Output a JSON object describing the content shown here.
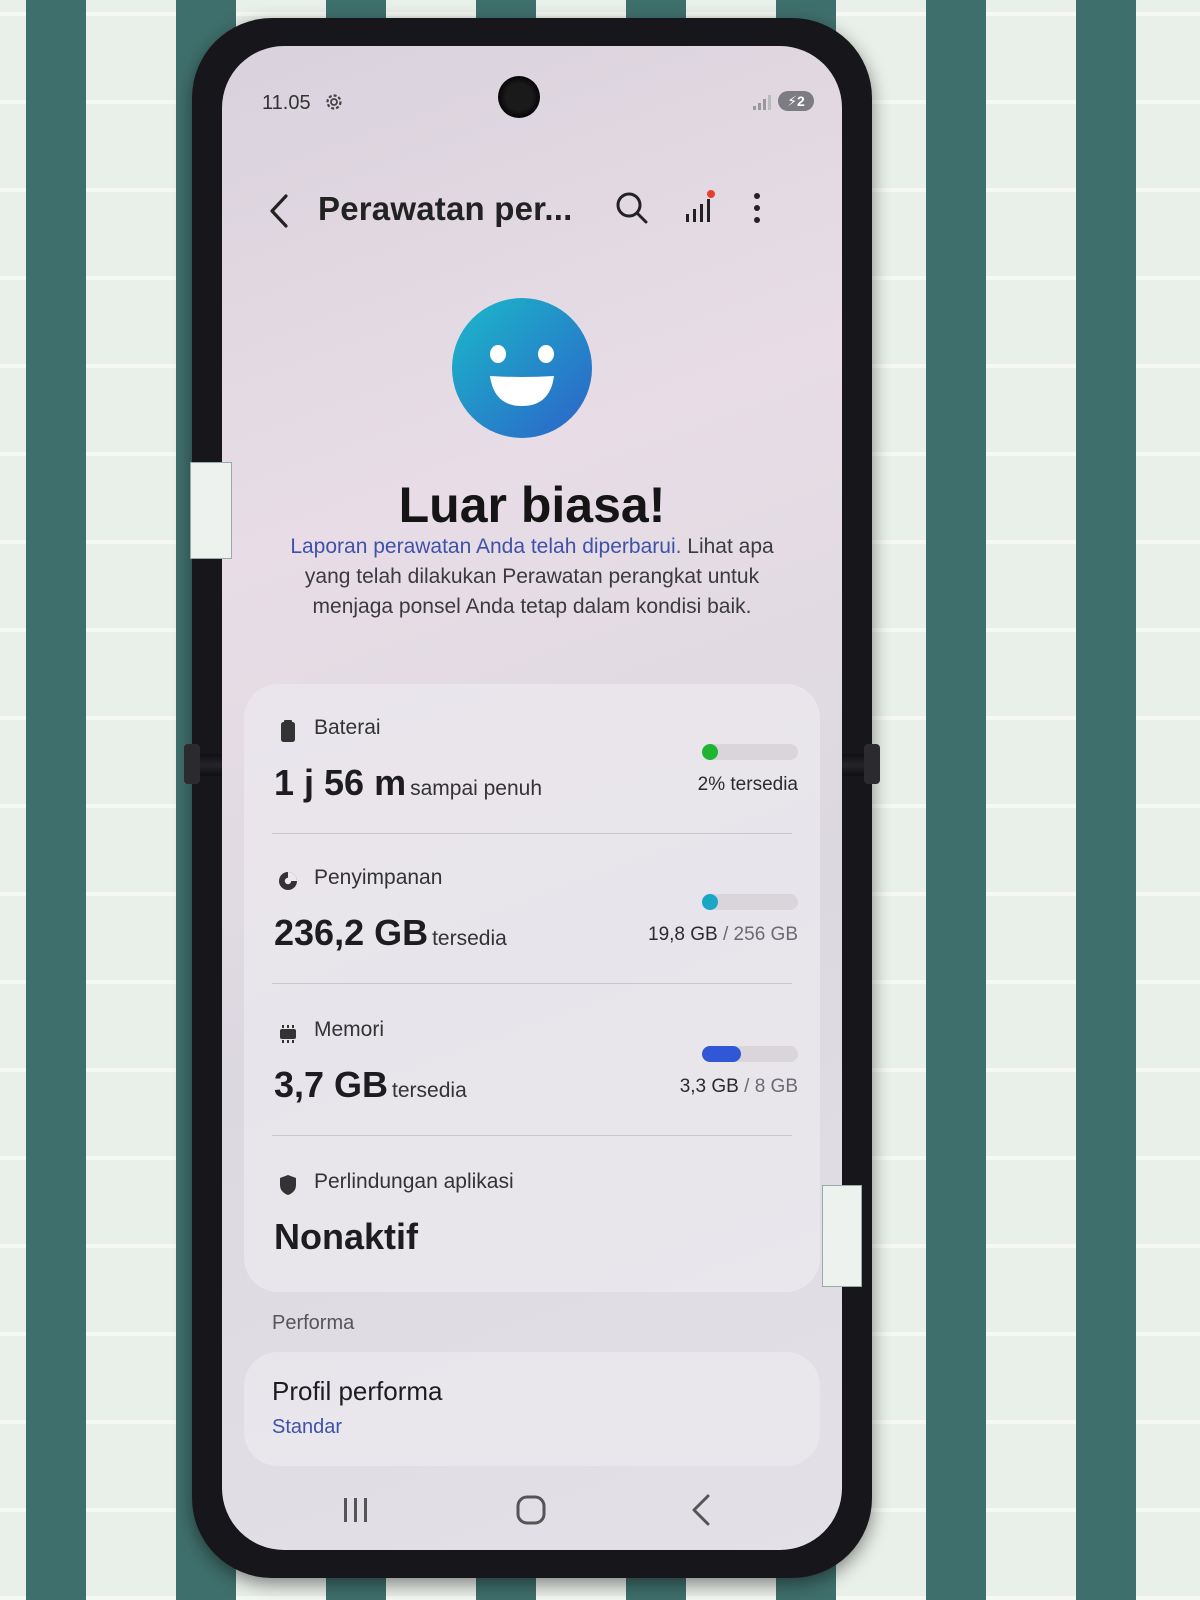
{
  "status_bar": {
    "time": "11.05",
    "battery_badge": "⚡2"
  },
  "app_bar": {
    "title": "Perawatan per..."
  },
  "hero": {
    "headline": "Luar biasa!",
    "link_text": "Laporan perawatan Anda telah diperbarui.",
    "description": " Lihat apa yang telah dilakukan Perawatan perangkat untuk menjaga ponsel Anda tetap dalam kondisi baik."
  },
  "battery": {
    "label": "Baterai",
    "value": "1 j 56 m",
    "suffix": "sampai penuh",
    "right": "2% tersedia",
    "level": 0.02,
    "color": "#1fb533"
  },
  "storage": {
    "label": "Penyimpanan",
    "value": "236,2 GB",
    "suffix": "tersedia",
    "used": "19,8 GB",
    "total": " / 256 GB",
    "level": 0.077,
    "color": "#1aa6c4"
  },
  "memory": {
    "label": "Memori",
    "value": "3,7 GB",
    "suffix": "tersedia",
    "used": "3,3 GB",
    "total": " / 8 GB",
    "level": 0.41,
    "color": "#2f57d6"
  },
  "protection": {
    "label": "Perlindungan aplikasi",
    "value": "Nonaktif"
  },
  "performance": {
    "section": "Performa",
    "title": "Profil performa",
    "subtitle": "Standar"
  }
}
